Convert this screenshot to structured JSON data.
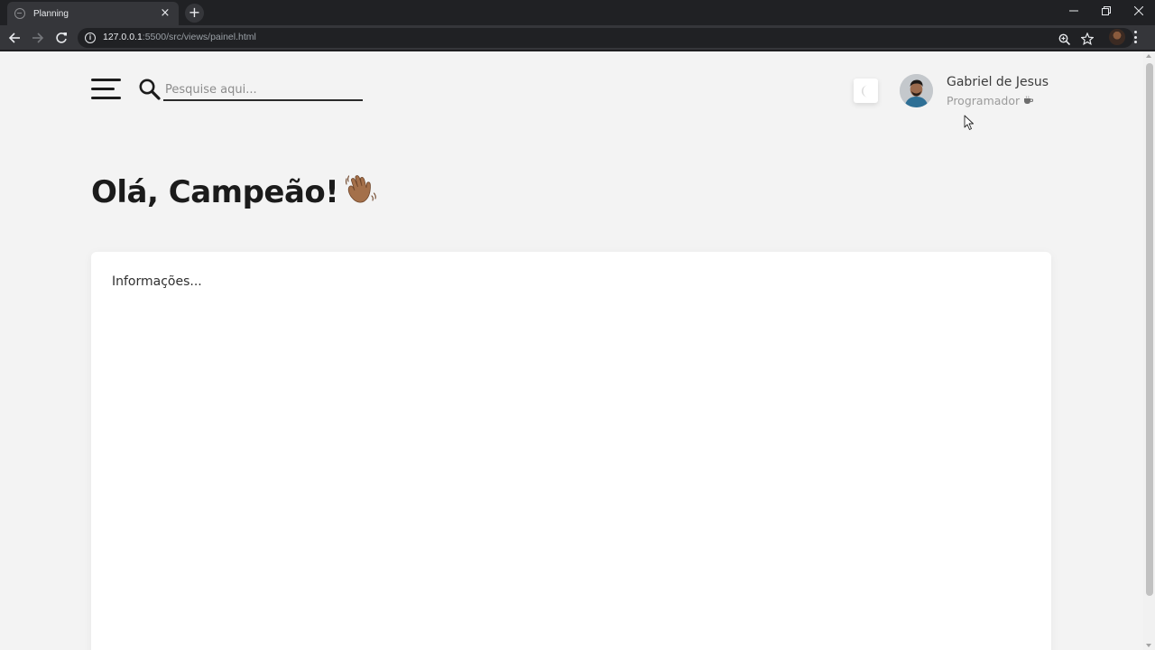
{
  "browser": {
    "tab_title": "Planning",
    "tab_close": "×",
    "new_tab": "+",
    "url_host": "127.0.0.1",
    "url_rest": ":5500/src/views/painel.html",
    "info_glyph": "i"
  },
  "header": {
    "search_placeholder": "Pesquise aqui...",
    "theme_icon": "moon-icon",
    "user": {
      "name": "Gabriel de Jesus",
      "role": "Programador",
      "role_icon": "coffee-icon"
    }
  },
  "main": {
    "greeting": "Olá, Campeão!",
    "greeting_icon": "waving-hand-icon",
    "card_title": "Informações..."
  },
  "colors": {
    "page_background": "#f3f3f3",
    "card_background": "#ffffff",
    "text_dark": "#1b1b1b",
    "text_muted": "#9b9b9b",
    "browser_frame": "#202124",
    "browser_toolbar": "#35363a"
  }
}
